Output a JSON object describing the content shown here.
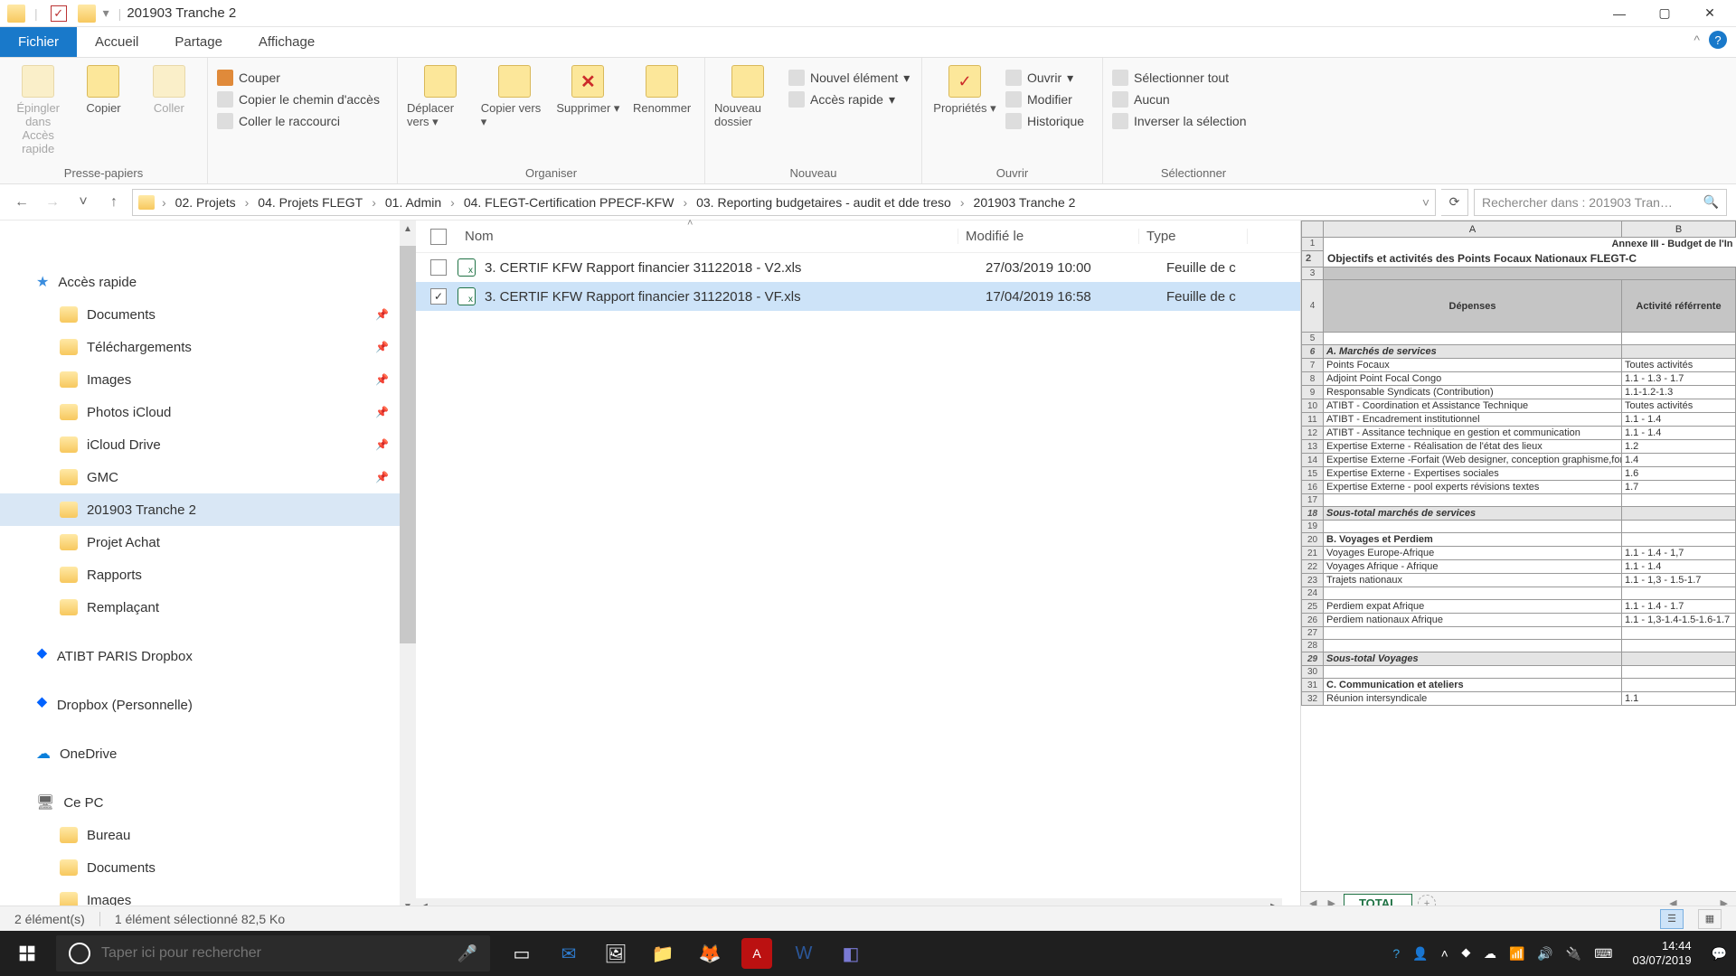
{
  "window": {
    "title": "201903 Tranche 2",
    "minimize": "—",
    "maximize": "▢",
    "close": "✕"
  },
  "tabs": {
    "file": "Fichier",
    "home": "Accueil",
    "share": "Partage",
    "view": "Affichage"
  },
  "ribbon": {
    "pin": "Épingler dans Accès rapide",
    "copy": "Copier",
    "paste": "Coller",
    "cut": "Couper",
    "copypath": "Copier le chemin d'accès",
    "pasteshort": "Coller le raccourci",
    "grp_clip": "Presse-papiers",
    "moveto": "Déplacer vers",
    "copyto": "Copier vers",
    "delete": "Supprimer",
    "rename": "Renommer",
    "grp_org": "Organiser",
    "newfolder": "Nouveau dossier",
    "newelem": "Nouvel élément",
    "quickaccess": "Accès rapide",
    "grp_new": "Nouveau",
    "props": "Propriétés",
    "open": "Ouvrir",
    "edit": "Modifier",
    "history": "Historique",
    "grp_open": "Ouvrir",
    "selall": "Sélectionner tout",
    "selnone": "Aucun",
    "invsel": "Inverser la sélection",
    "grp_sel": "Sélectionner"
  },
  "breadcrumbs": [
    "02. Projets",
    "04. Projets FLEGT",
    "01. Admin",
    "04. FLEGT-Certification PPECF-KFW",
    "03. Reporting budgetaires - audit et dde treso",
    "201903 Tranche 2"
  ],
  "search_placeholder": "Rechercher dans : 201903 Tran…",
  "cols": {
    "name": "Nom",
    "modified": "Modifié le",
    "type": "Type"
  },
  "files": [
    {
      "name": "3. CERTIF KFW  Rapport financier 31122018 - V2.xls",
      "modified": "27/03/2019 10:00",
      "type": "Feuille de c",
      "selected": false
    },
    {
      "name": "3. CERTIF KFW  Rapport financier 31122018 - VF.xls",
      "modified": "17/04/2019 16:58",
      "type": "Feuille de c",
      "selected": true
    }
  ],
  "nav": {
    "quick": "Accès rapide",
    "items1": [
      "Documents",
      "Téléchargements",
      "Images",
      "Photos iCloud",
      "iCloud Drive",
      "GMC",
      "201903 Tranche 2",
      "Projet Achat",
      "Rapports",
      "Remplaçant"
    ],
    "dropbox1": "ATIBT PARIS Dropbox",
    "dropbox2": "Dropbox (Personnelle)",
    "onedrive": "OneDrive",
    "thispc": "Ce PC",
    "items2": [
      "Bureau",
      "Documents",
      "Images"
    ]
  },
  "status": {
    "count": "2 élément(s)",
    "sel": "1 élément sélectionné  82,5 Ko"
  },
  "taskbar": {
    "search": "Taper ici pour rechercher",
    "time": "14:44",
    "date": "03/07/2019"
  },
  "preview": {
    "colA": "A",
    "colB": "B",
    "title1": "Annexe III - Budget de l'In",
    "title2": "Objectifs et activités des Points Focaux Nationaux FLEGT-C",
    "hdrA": "Dépenses",
    "hdrB": "Activité référrente",
    "sheet": "TOTAL",
    "rows": [
      {
        "n": 6,
        "a": "A. Marchés de services",
        "b": "",
        "sec": true
      },
      {
        "n": 7,
        "a": "Points Focaux",
        "b": "Toutes activités"
      },
      {
        "n": 8,
        "a": "Adjoint Point Focal Congo",
        "b": "1.1 - 1.3 - 1.7"
      },
      {
        "n": 9,
        "a": "Responsable Syndicats (Contribution)",
        "b": "1.1-1.2-1.3"
      },
      {
        "n": 10,
        "a": "ATIBT - Coordination et Assistance Technique",
        "b": "Toutes activités"
      },
      {
        "n": 11,
        "a": "ATIBT - Encadrement institutionnel",
        "b": "1.1 - 1.4"
      },
      {
        "n": 12,
        "a": "ATIBT - Assitance technique en gestion et communication",
        "b": "1.1 - 1.4"
      },
      {
        "n": 13,
        "a": "Expertise Externe - Réalisation de l'état des lieux",
        "b": "1.2"
      },
      {
        "n": 14,
        "a": "Expertise Externe -Forfait (Web designer, conception graphisme,formation wordpress, autres outils)",
        "b": "1.4"
      },
      {
        "n": 15,
        "a": "Expertise Externe - Expertises sociales",
        "b": "1.6"
      },
      {
        "n": 16,
        "a": "Expertise Externe - pool experts révisions textes",
        "b": "1.7"
      },
      {
        "n": 17,
        "a": "",
        "b": ""
      },
      {
        "n": 18,
        "a": "Sous-total marchés de services",
        "b": "",
        "sec": true
      },
      {
        "n": 19,
        "a": "",
        "b": ""
      },
      {
        "n": 20,
        "a": "B. Voyages et Perdiem",
        "b": "",
        "sec": false,
        "bold": true
      },
      {
        "n": 21,
        "a": "Voyages Europe-Afrique",
        "b": "1.1 - 1.4 - 1,7"
      },
      {
        "n": 22,
        "a": "Voyages Afrique - Afrique",
        "b": "1.1 - 1.4"
      },
      {
        "n": 23,
        "a": "Trajets nationaux",
        "b": "1.1 - 1,3 - 1.5-1.7"
      },
      {
        "n": 24,
        "a": "",
        "b": ""
      },
      {
        "n": 25,
        "a": "Perdiem expat Afrique",
        "b": "1.1 - 1.4 - 1.7"
      },
      {
        "n": 26,
        "a": "Perdiem nationaux Afrique",
        "b": "1.1 - 1,3-1.4-1.5-1.6-1.7"
      },
      {
        "n": 27,
        "a": "",
        "b": ""
      },
      {
        "n": 28,
        "a": "",
        "b": ""
      },
      {
        "n": 29,
        "a": "Sous-total Voyages",
        "b": "",
        "sec": true
      },
      {
        "n": 30,
        "a": "",
        "b": ""
      },
      {
        "n": 31,
        "a": "C. Communication et ateliers",
        "b": "",
        "bold": true
      },
      {
        "n": 32,
        "a": "Réunion intersyndicale",
        "b": "1.1"
      }
    ]
  }
}
